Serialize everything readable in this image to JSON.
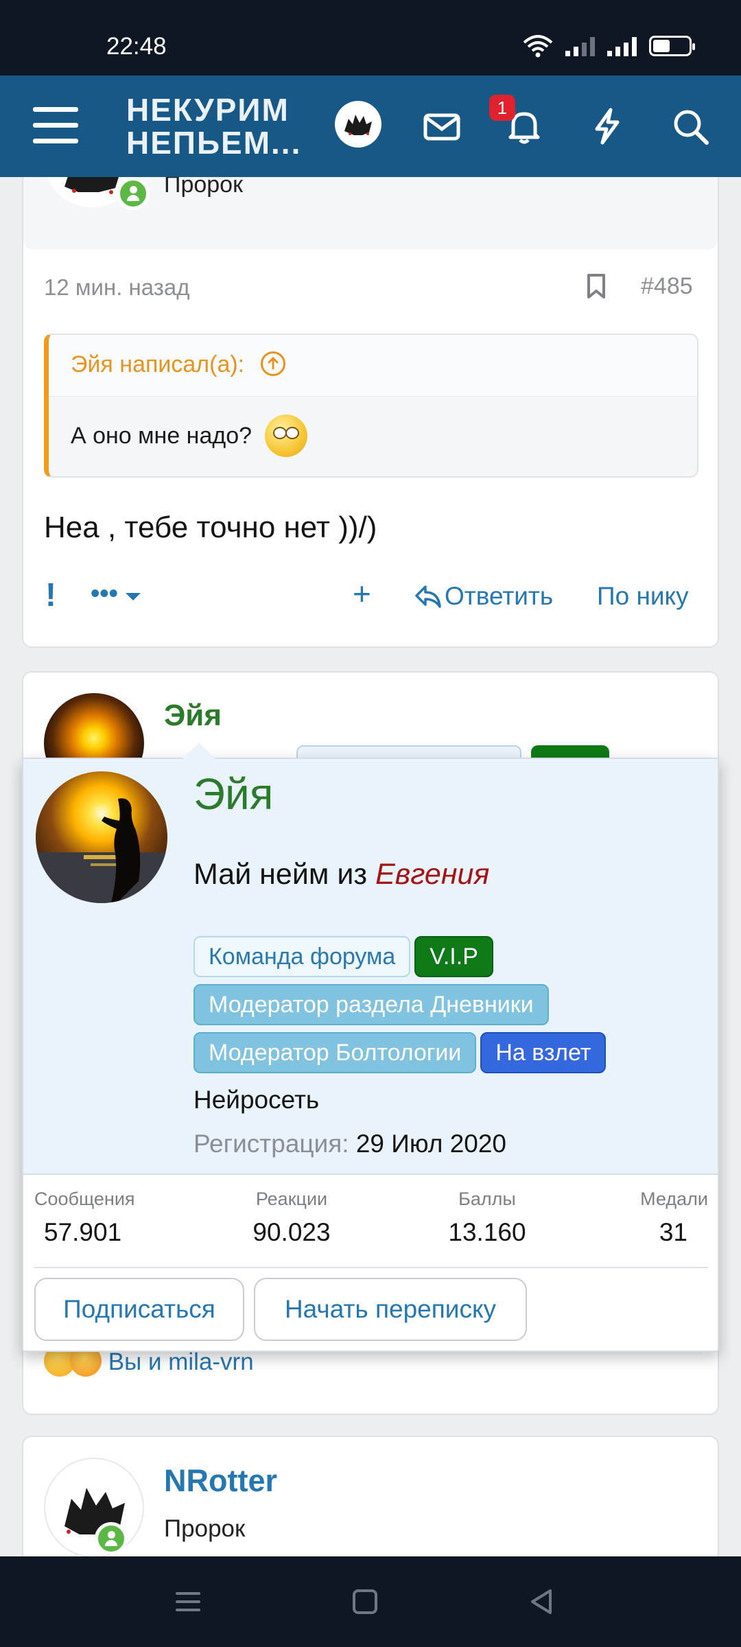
{
  "status_bar": {
    "time": "22:48"
  },
  "header": {
    "logo_line1": "НЕКУРИМ",
    "logo_line2": "НЕПЬЕМ...",
    "notification_count": "1",
    "icons": [
      "menu-icon",
      "avatar",
      "mail-icon",
      "bell-icon",
      "lightning-icon",
      "search-icon"
    ]
  },
  "post1": {
    "user_role": "Пророк",
    "time": "12 мин. назад",
    "post_number": "#485",
    "quote": {
      "author_line": "Эйя написал(а):",
      "text": "А оно мне надо?"
    },
    "text": "Неа , тебе точно нет ))/)",
    "actions": {
      "report": "!",
      "more": "•••",
      "add": "+",
      "reply": "Ответить",
      "by_nick": "По нику"
    }
  },
  "post2": {
    "username": "Эйя",
    "reactions_text": "Вы и mila-vrn"
  },
  "post3": {
    "username": "NRotter",
    "user_role": "Пророк"
  },
  "popup": {
    "name": "Эйя",
    "title_prefix": "Май нейм из",
    "title_name": "Евгения",
    "banners": {
      "team": "Команда форума",
      "vip": "V.I.P",
      "mod_diaries": "Модератор раздела Дневники",
      "mod_talk": "Модератор Болтологии",
      "fly": "На взлет"
    },
    "rank": "Нейросеть",
    "reg_label": "Регистрация:",
    "reg_date": "29 Июл 2020",
    "stats": {
      "messages_label": "Сообщения",
      "messages": "57.901",
      "reactions_label": "Реакции",
      "reactions": "90.023",
      "points_label": "Баллы",
      "points": "13.160",
      "medals_label": "Медали",
      "medals": "31"
    },
    "buttons": {
      "follow": "Подписаться",
      "start_conversation": "Начать переписку"
    }
  },
  "colors": {
    "header_bg": "#185886",
    "link": "#2577b1",
    "username_green": "#2c7a2c",
    "quote_accent": "#f29a1a",
    "vip_green": "#0d7a17",
    "fly_blue": "#3468de"
  }
}
